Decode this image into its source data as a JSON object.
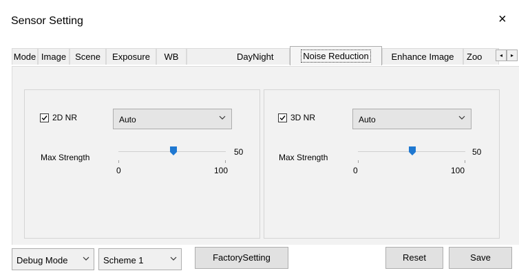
{
  "window": {
    "title": "Sensor Setting",
    "close_glyph": "×"
  },
  "tabs": [
    {
      "label": "Mode"
    },
    {
      "label": "Image"
    },
    {
      "label": "Scene"
    },
    {
      "label": "Exposure"
    },
    {
      "label": "WB"
    },
    {
      "label": "DayNight"
    },
    {
      "label": "Noise Reduction",
      "active": true
    },
    {
      "label": "Enhance Image"
    },
    {
      "label": "Zoo"
    }
  ],
  "tab_scroll": {
    "left_glyph": "◂",
    "right_glyph": "▸"
  },
  "nr2d": {
    "enable_label": "2D NR",
    "checked": true,
    "mode_value": "Auto",
    "strength_label": "Max Strength",
    "value": "50",
    "min": "0",
    "max": "100"
  },
  "nr3d": {
    "enable_label": "3D NR",
    "checked": true,
    "mode_value": "Auto",
    "strength_label": "Max Strength",
    "value": "50",
    "min": "0",
    "max": "100"
  },
  "bottom": {
    "debug_mode": "Debug Mode",
    "scheme": "Scheme 1",
    "factory_button": "FactorySetting",
    "reset_button": "Reset",
    "save_button": "Save"
  },
  "colors": {
    "slider_thumb": "#1f78d1",
    "panel": "#f2f2f2"
  },
  "icons": [
    "close-icon",
    "check-icon",
    "chevron-down-icon",
    "arrow-left-icon",
    "arrow-right-icon"
  ]
}
